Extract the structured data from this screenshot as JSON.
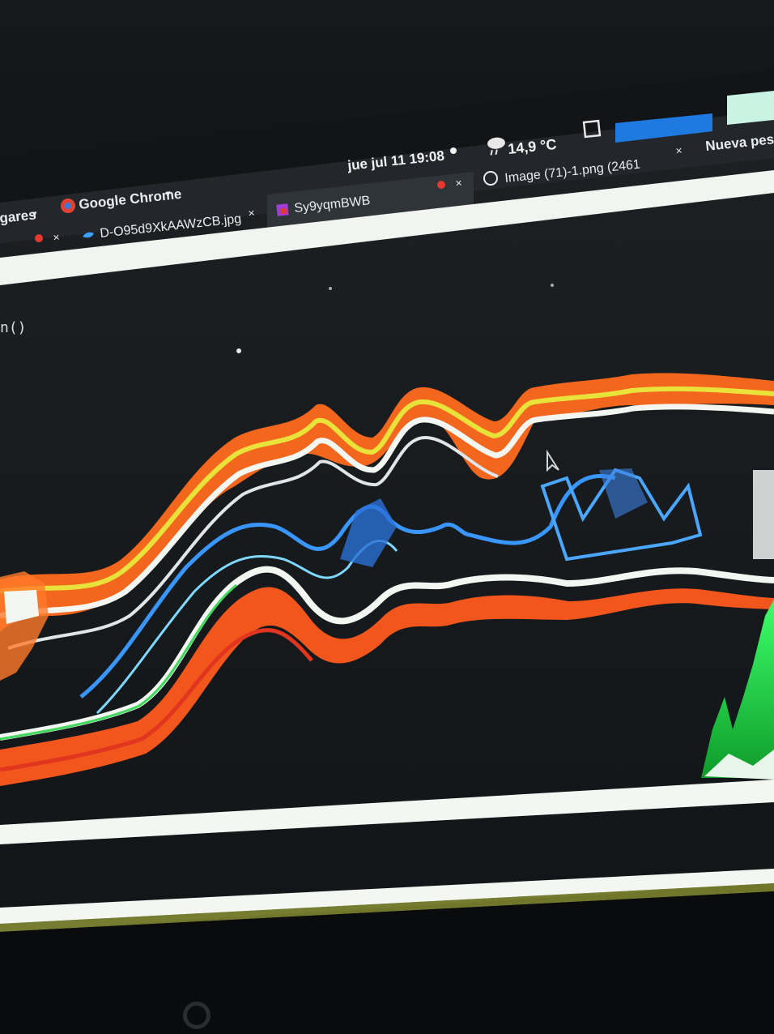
{
  "system_bar": {
    "datetime": "jue jul 11  19:08",
    "weather": "14,9 °C"
  },
  "browser": {
    "menu_left": "gares",
    "menu_app": "Google Chrome",
    "tabs": [
      {
        "label": "D-O95d9XkAAWzCB.jpg",
        "icon": "twitter-icon"
      },
      {
        "label": "Sy9yqmBWB",
        "icon": "app-icon",
        "active": true
      },
      {
        "label": "Image (71)-1.png (2461",
        "icon": "smiley-icon"
      },
      {
        "label": "Nueva pes",
        "icon": ""
      }
    ]
  },
  "code": {
    "visible_fragment": "n()"
  },
  "colors": {
    "background": "#0b0d0f",
    "white_band": "#f4f6f2",
    "orange_layer": "#ff5a1e",
    "blue_layer": "#2f8cff",
    "green_layer": "#22d84a",
    "yellow_layer": "#e8e23a"
  }
}
